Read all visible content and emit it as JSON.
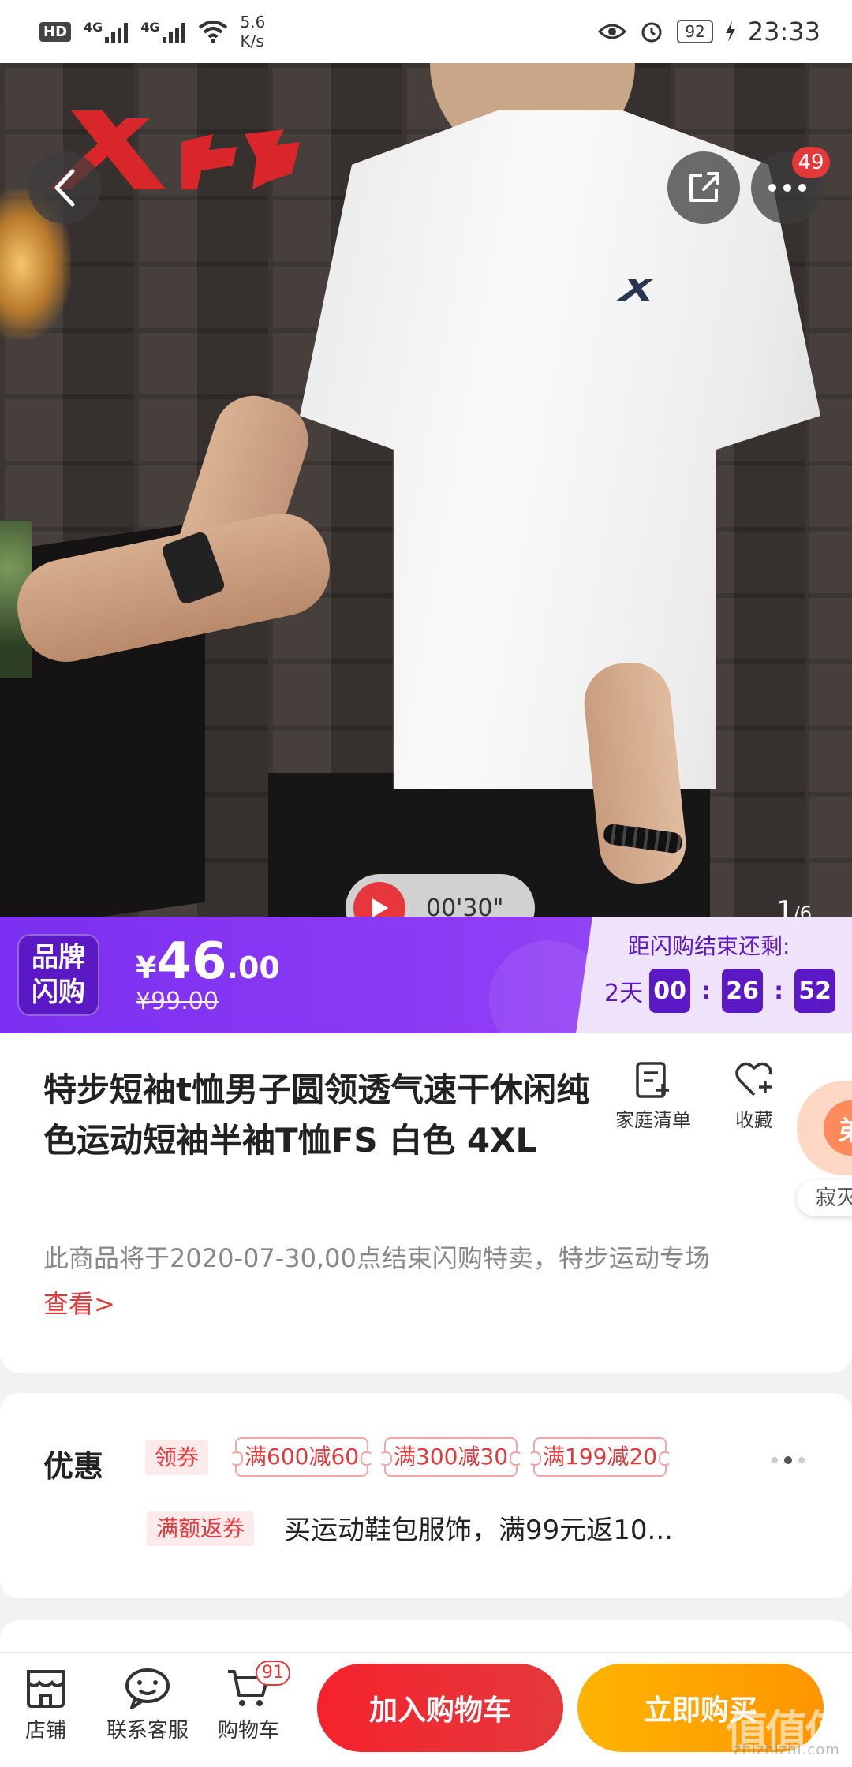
{
  "status_bar": {
    "hd": "HD",
    "sim1": "1",
    "network1": "4G",
    "network2": "4G",
    "speed_value": "5.6",
    "speed_unit": "K/s",
    "battery": "92",
    "time": "23:33"
  },
  "gallery": {
    "more_badge": "49",
    "video_duration": "00'30\"",
    "page_current": "1",
    "page_total": "/6"
  },
  "flash_sale": {
    "badge_line1": "品牌",
    "badge_line2": "闪购",
    "currency": "¥",
    "price_int": "46",
    "price_dec": ".00",
    "original_price": "¥99.00",
    "countdown_label": "距闪购结束还剩:",
    "days": "2天",
    "hours": "00",
    "minutes": "26",
    "seconds": "52",
    "separator": ":"
  },
  "product": {
    "title": "特步短袖t恤男子圆领透气速干休闲纯色运动短袖半袖T恤FS 白色 4XL",
    "family_list_label": "家庭清单",
    "favorite_label": "收藏",
    "side_peek_char": "弟",
    "side_peek_label": "寂灭",
    "notice": "此商品将于2020-07-30,00点结束闪购特卖，特步运动专场",
    "notice_link": "查看>"
  },
  "promotions": {
    "title": "优惠",
    "get_coupon_tag": "领券",
    "coupons": [
      "满600减60",
      "满300减30",
      "满199减20"
    ],
    "return_tag": "满额返券",
    "return_desc": "买运动鞋包服饰，满99元返10..."
  },
  "bottom_bar": {
    "shop_label": "店铺",
    "service_label": "联系客服",
    "cart_label": "购物车",
    "cart_count": "91",
    "add_to_cart": "加入购物车",
    "buy_now": "立即购买"
  },
  "watermark": {
    "text": "值值值",
    "domain": "zhizhizhi.com"
  },
  "colors": {
    "accent_red": "#e4393c",
    "flash_purple": "#7b2ff0",
    "buy_orange": "#ff9500"
  }
}
